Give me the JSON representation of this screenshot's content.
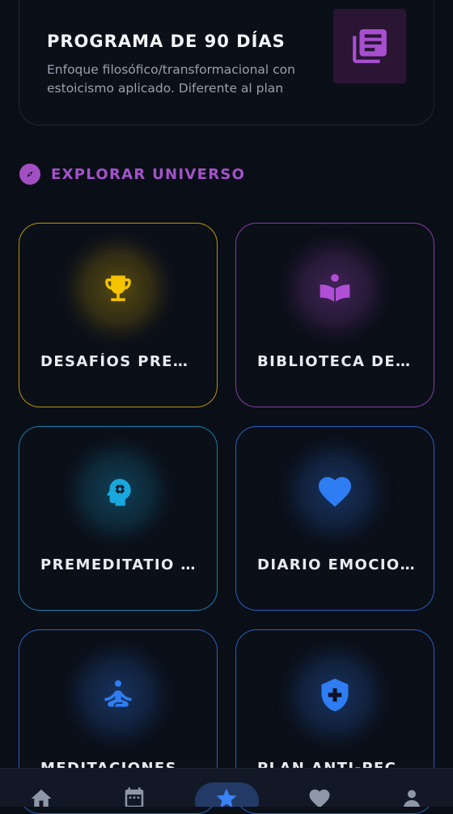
{
  "program": {
    "title": "PROGRAMA DE 90 DÍAS",
    "description": "Enfoque filosófico/transformacional con estoicismo aplicado. Diferente al plan",
    "icon": "library-books-icon",
    "accent": "#a84fd0"
  },
  "section": {
    "title": "EXPLORAR UNIVERSO",
    "icon": "compass-icon",
    "color": "#a452c9"
  },
  "tiles": [
    {
      "label": "DESAFÍOS PREMI…",
      "icon": "trophy-icon",
      "color": "#f5c400"
    },
    {
      "label": "BIBLIOTECA DEL …",
      "icon": "reading-book-icon",
      "color": "#b04fd6"
    },
    {
      "label": "PREMEDITATIO M…",
      "icon": "mind-gear-icon",
      "color": "#1aa7dd"
    },
    {
      "label": "DIARIO EMOCION…",
      "icon": "heart-icon",
      "color": "#2f7df2"
    },
    {
      "label": "MEDITACIONES E…",
      "icon": "meditation-icon",
      "color": "#2f7df2"
    },
    {
      "label": "PLAN ANTI-PECA…",
      "icon": "shield-cross-icon",
      "color": "#2f7df2"
    }
  ],
  "nav": {
    "items": [
      {
        "icon": "home-icon"
      },
      {
        "icon": "calendar-icon"
      },
      {
        "icon": "star-icon",
        "active": true
      },
      {
        "icon": "heart-icon"
      },
      {
        "icon": "profile-icon"
      }
    ],
    "active_color": "#3b82f6",
    "inactive_color": "#8d97a8"
  }
}
